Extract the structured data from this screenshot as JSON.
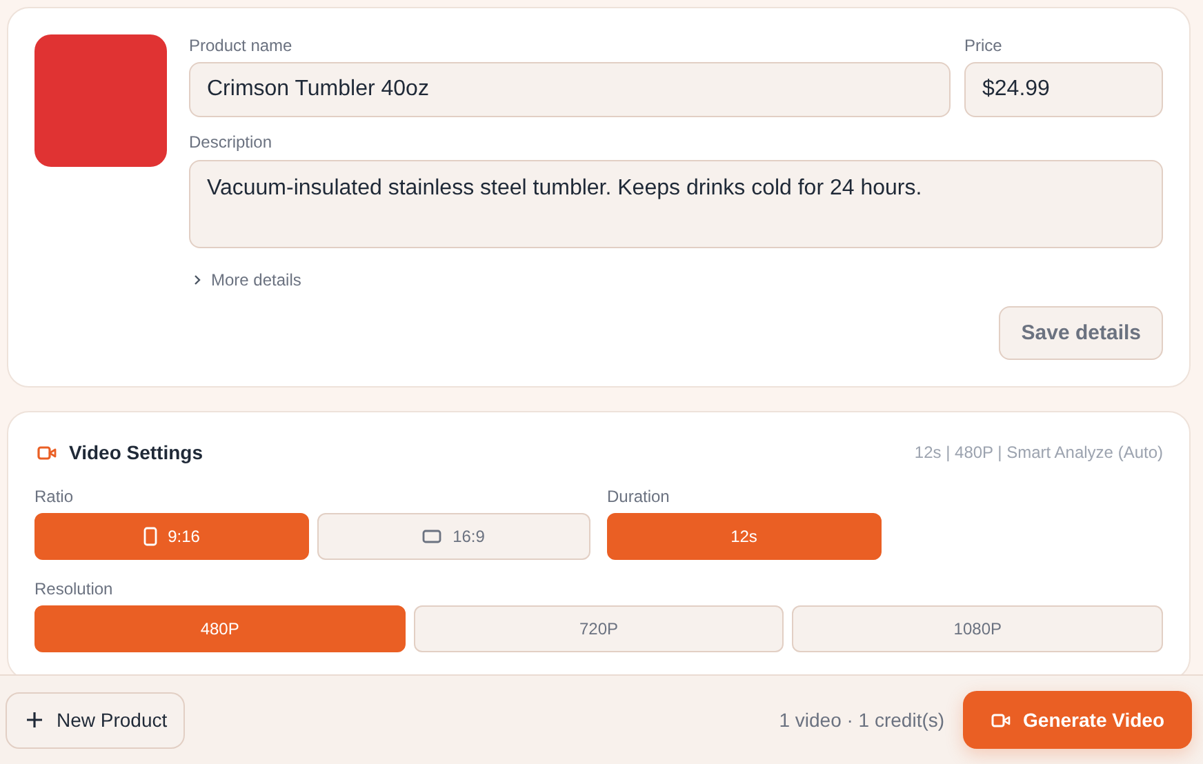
{
  "product": {
    "name_label": "Product name",
    "name": "Crimson Tumbler 40oz",
    "price_label": "Price",
    "price": "$24.99",
    "description_label": "Description",
    "description": "Vacuum-insulated stainless steel tumbler. Keeps drinks cold for 24 hours.",
    "more_details": {
      "label": "More details",
      "expanded": false
    },
    "save_button": "Save details"
  },
  "video_settings": {
    "title": "Video Settings",
    "summary": "12s | 480P | Smart Analyze (Auto)",
    "ratio": {
      "label": "Ratio",
      "options": [
        {
          "label": "9:16",
          "kind": "portrait",
          "selected": true
        },
        {
          "label": "16:9",
          "kind": "landscape",
          "selected": false
        }
      ]
    },
    "duration": {
      "label": "Duration",
      "options": [
        {
          "label": "12s",
          "selected": true
        }
      ]
    },
    "resolution": {
      "label": "Resolution",
      "options": [
        {
          "label": "480P",
          "selected": true
        },
        {
          "label": "720P",
          "selected": false
        },
        {
          "label": "1080P",
          "selected": false
        }
      ]
    }
  },
  "footer": {
    "new_button": "New Product",
    "summary": "1 video · 1 credit(s)",
    "generate_button": "Generate Video"
  }
}
